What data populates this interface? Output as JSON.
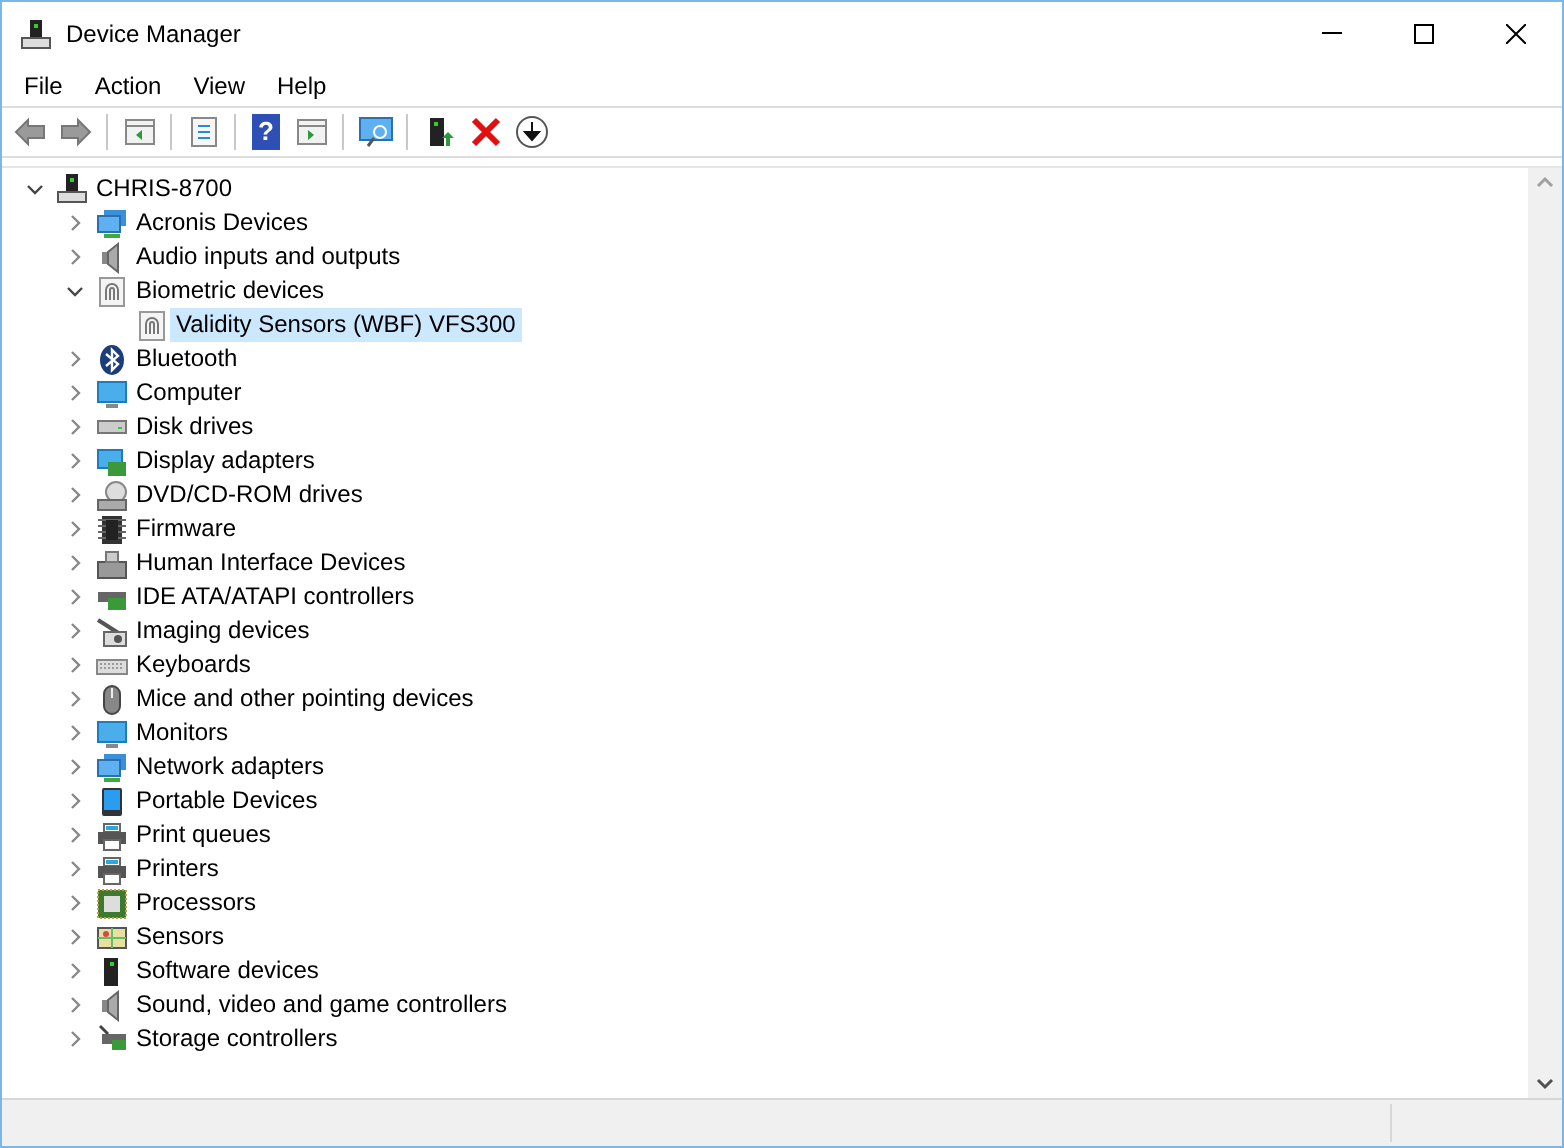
{
  "window": {
    "title": "Device Manager"
  },
  "menu": [
    "File",
    "Action",
    "View",
    "Help"
  ],
  "toolbar": {
    "help_glyph": "?"
  },
  "tree": {
    "label": "CHRIS-8700",
    "expanded": true,
    "children": [
      {
        "label": "Acronis Devices",
        "kind": "network",
        "expanded": false,
        "selected": false
      },
      {
        "label": "Audio inputs and outputs",
        "kind": "speaker",
        "expanded": false,
        "selected": false
      },
      {
        "label": "Biometric devices",
        "kind": "fingerprint",
        "expanded": true,
        "selected": false,
        "children": [
          {
            "label": "Validity Sensors (WBF) VFS300",
            "kind": "fingerprint",
            "selected": true
          }
        ]
      },
      {
        "label": "Bluetooth",
        "kind": "bluetooth",
        "expanded": false,
        "selected": false
      },
      {
        "label": "Computer",
        "kind": "monitor",
        "expanded": false,
        "selected": false
      },
      {
        "label": "Disk drives",
        "kind": "disk",
        "expanded": false,
        "selected": false
      },
      {
        "label": "Display adapters",
        "kind": "display",
        "expanded": false,
        "selected": false
      },
      {
        "label": "DVD/CD-ROM drives",
        "kind": "optical",
        "expanded": false,
        "selected": false
      },
      {
        "label": "Firmware",
        "kind": "chip",
        "expanded": false,
        "selected": false
      },
      {
        "label": "Human Interface Devices",
        "kind": "hid",
        "expanded": false,
        "selected": false
      },
      {
        "label": "IDE ATA/ATAPI controllers",
        "kind": "card",
        "expanded": false,
        "selected": false
      },
      {
        "label": "Imaging devices",
        "kind": "camera",
        "expanded": false,
        "selected": false
      },
      {
        "label": "Keyboards",
        "kind": "keyboard",
        "expanded": false,
        "selected": false
      },
      {
        "label": "Mice and other pointing devices",
        "kind": "mouse",
        "expanded": false,
        "selected": false
      },
      {
        "label": "Monitors",
        "kind": "monitor",
        "expanded": false,
        "selected": false
      },
      {
        "label": "Network adapters",
        "kind": "network",
        "expanded": false,
        "selected": false
      },
      {
        "label": "Portable Devices",
        "kind": "portable",
        "expanded": false,
        "selected": false
      },
      {
        "label": "Print queues",
        "kind": "printer",
        "expanded": false,
        "selected": false
      },
      {
        "label": "Printers",
        "kind": "printer",
        "expanded": false,
        "selected": false
      },
      {
        "label": "Processors",
        "kind": "processor",
        "expanded": false,
        "selected": false
      },
      {
        "label": "Sensors",
        "kind": "sensor",
        "expanded": false,
        "selected": false
      },
      {
        "label": "Software devices",
        "kind": "software",
        "expanded": false,
        "selected": false
      },
      {
        "label": "Sound, video and game controllers",
        "kind": "speaker",
        "expanded": false,
        "selected": false
      },
      {
        "label": "Storage controllers",
        "kind": "storage",
        "expanded": false,
        "selected": false
      }
    ]
  }
}
